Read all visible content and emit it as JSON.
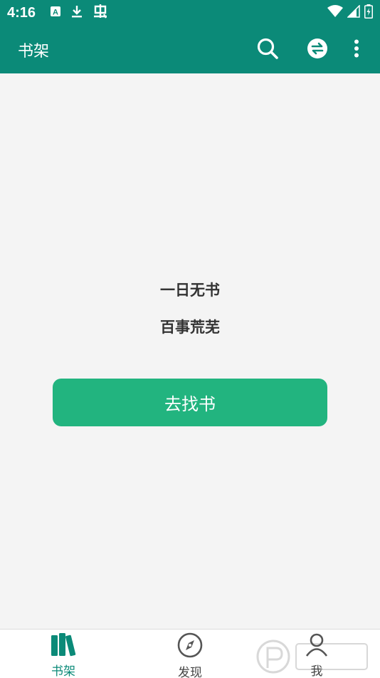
{
  "status_bar": {
    "time": "4:16",
    "left_icons": [
      "a-letter-icon",
      "download-icon",
      "bug-icon"
    ],
    "right_icons": [
      "wifi-icon",
      "signal-icon",
      "battery-icon"
    ]
  },
  "app_bar": {
    "title": "书架",
    "actions": [
      "search-icon",
      "swap-icon",
      "more-vert-icon"
    ],
    "color": "#0b8a78"
  },
  "empty_state": {
    "line1": "一日无书",
    "line2": "百事荒芜",
    "button_label": "去找书",
    "button_color": "#22b47f"
  },
  "bottom_nav": {
    "items": [
      {
        "label": "书架",
        "icon": "bookshelf-icon",
        "active": true
      },
      {
        "label": "发现",
        "icon": "compass-icon",
        "active": false
      },
      {
        "label": "我",
        "icon": "person-icon",
        "active": false
      }
    ]
  }
}
